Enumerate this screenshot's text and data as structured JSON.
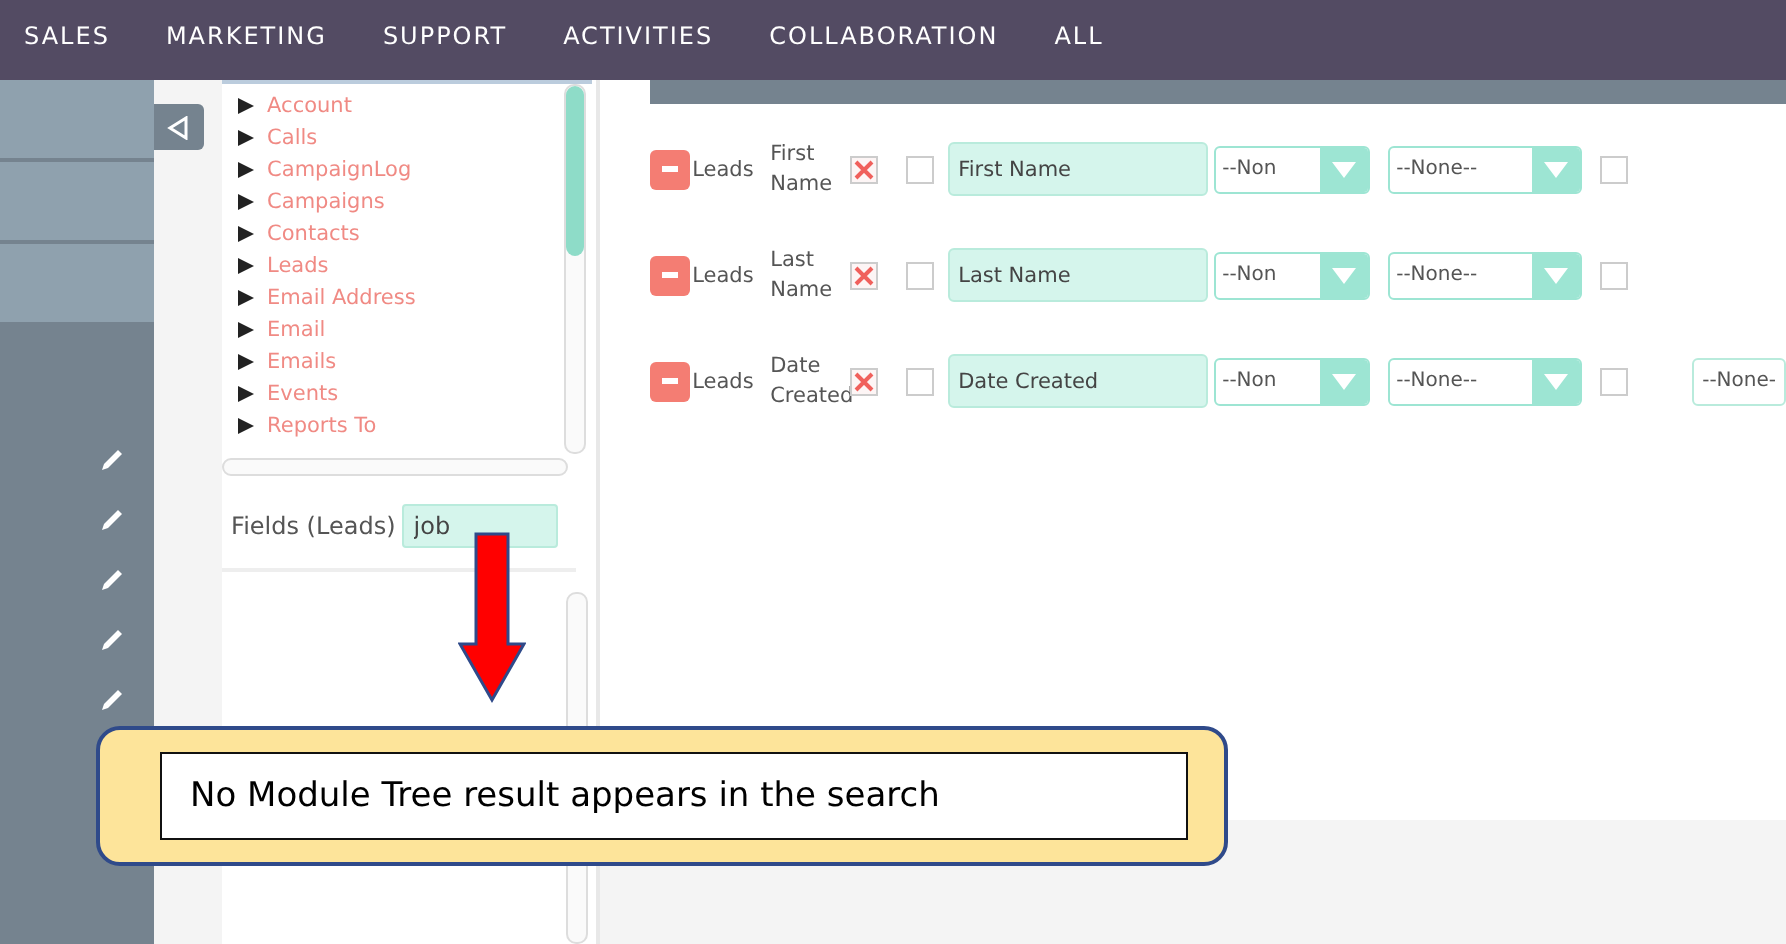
{
  "nav": [
    {
      "label": "SALES"
    },
    {
      "label": "MARKETING"
    },
    {
      "label": "SUPPORT"
    },
    {
      "label": "ACTIVITIES"
    },
    {
      "label": "COLLABORATION"
    },
    {
      "label": "ALL"
    }
  ],
  "module_tree": [
    "Account",
    "Calls",
    "CampaignLog",
    "Campaigns",
    "Contacts",
    "Leads",
    "Email Address",
    "Email",
    "Emails",
    "Events",
    "Reports To"
  ],
  "fields_filter": {
    "label": "Fields (Leads)",
    "value": "job"
  },
  "rows": [
    {
      "module": "Leads",
      "field": "First Name",
      "display": true,
      "link": false,
      "label": "First Name",
      "function": "--Non",
      "sort": "--None--",
      "group": false
    },
    {
      "module": "Leads",
      "field": "Last Name",
      "display": true,
      "link": false,
      "label": "Last Name",
      "function": "--Non",
      "sort": "--None--",
      "group": false
    },
    {
      "module": "Leads",
      "field": "Date Created",
      "display": true,
      "link": false,
      "label": "Date Created",
      "function": "--Non",
      "sort": "--None--",
      "group": false,
      "format": "--None-"
    }
  ],
  "callout": "No Module Tree result appears in the search"
}
